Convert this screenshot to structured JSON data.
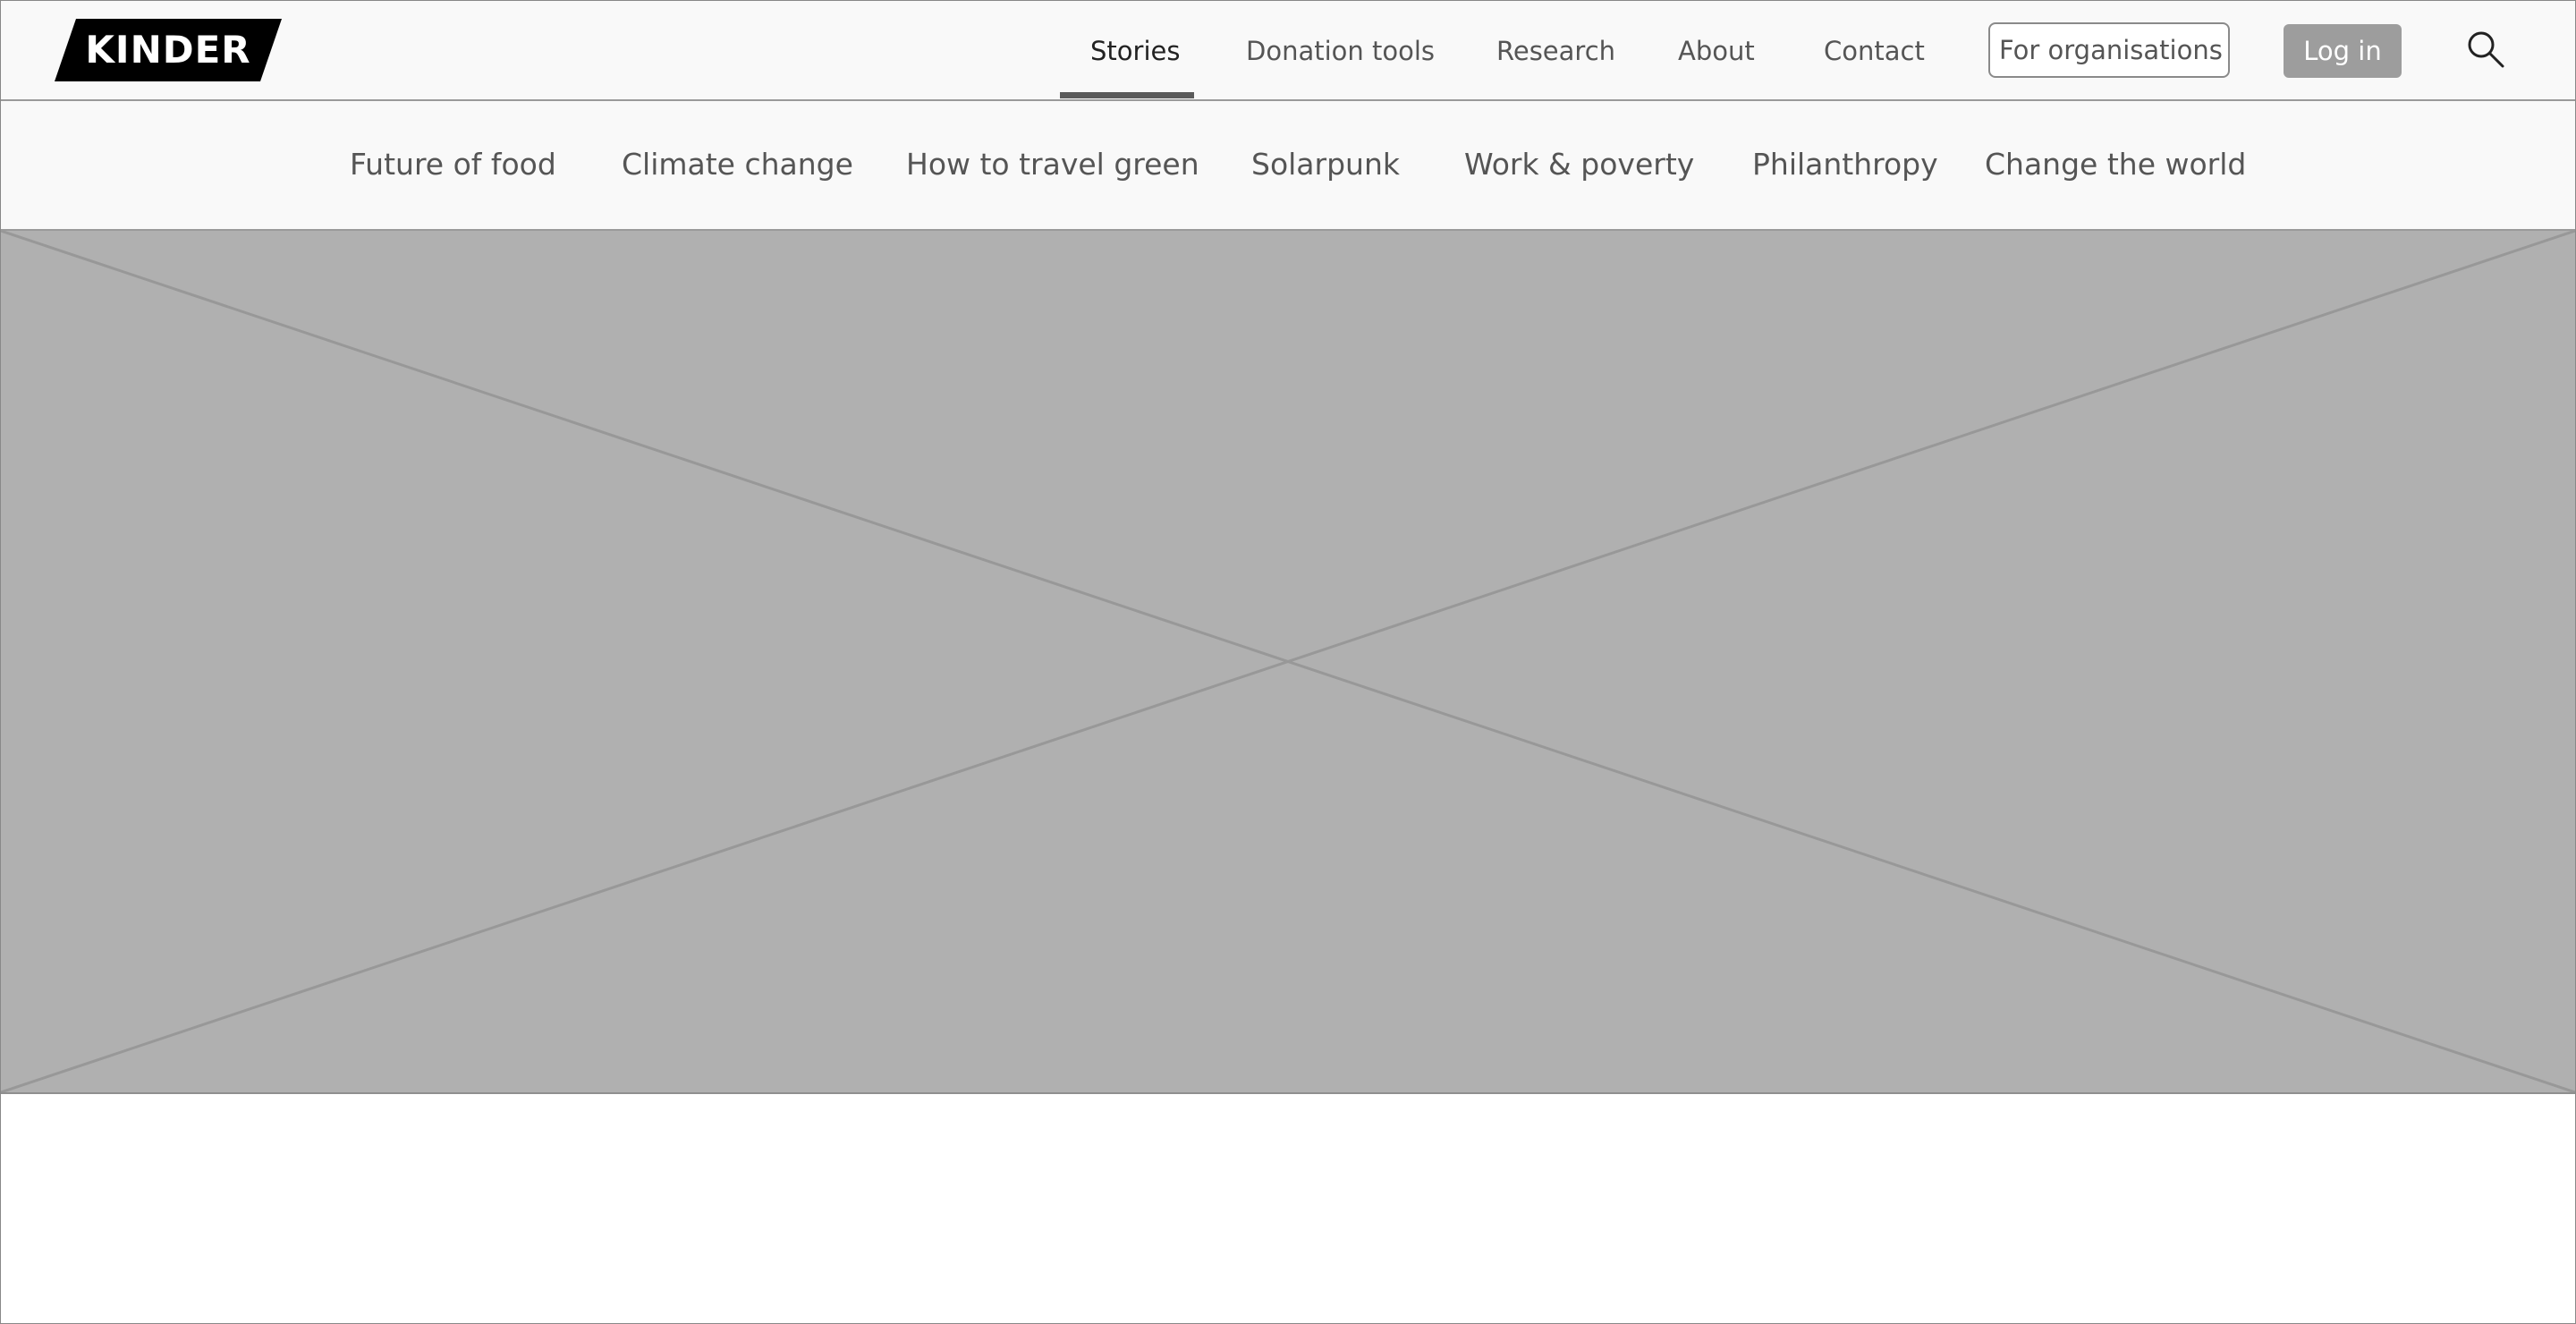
{
  "brand": {
    "logo_text": "KINDER"
  },
  "header": {
    "nav": [
      {
        "label": "Stories",
        "active": true
      },
      {
        "label": "Donation tools",
        "active": false
      },
      {
        "label": "Research",
        "active": false
      },
      {
        "label": "About",
        "active": false
      },
      {
        "label": "Contact",
        "active": false
      }
    ],
    "org_button": "For organisations",
    "login_button": "Log in",
    "search_icon": "search-icon"
  },
  "categories": [
    {
      "label": "Future of food"
    },
    {
      "label": "Climate change"
    },
    {
      "label": "How to travel green"
    },
    {
      "label": "Solarpunk"
    },
    {
      "label": "Work & poverty"
    },
    {
      "label": "Philanthropy"
    },
    {
      "label": "Change the world"
    }
  ],
  "hero": {
    "type": "image-placeholder"
  },
  "colors": {
    "header_bg": "#f9f9f9",
    "placeholder": "#b0b0b0",
    "button_gray": "#9d9d9d",
    "text": "#555555"
  }
}
